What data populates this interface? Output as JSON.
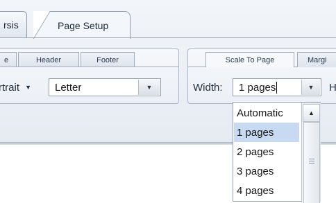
{
  "main_tabs": [
    {
      "label": "rsis"
    },
    {
      "label": "Page Setup"
    }
  ],
  "sub_tabs_left": [
    {
      "label": "e"
    },
    {
      "label": "Header"
    },
    {
      "label": "Footer"
    }
  ],
  "sub_tabs_right": [
    {
      "label": "Scale To Page"
    },
    {
      "label": "Margi"
    }
  ],
  "orientation": {
    "label": "rtrait"
  },
  "paper_size": {
    "value": "Letter"
  },
  "width": {
    "label": "Width:",
    "value": "1 pages"
  },
  "height": {
    "label": "H"
  },
  "width_dropdown": {
    "options": [
      "Automatic",
      "1 pages",
      "2 pages",
      "3 pages",
      "4 pages"
    ],
    "selected": "1 pages"
  },
  "colors": {
    "selected_highlight": "#c7daf1",
    "border": "#8f9dae"
  }
}
